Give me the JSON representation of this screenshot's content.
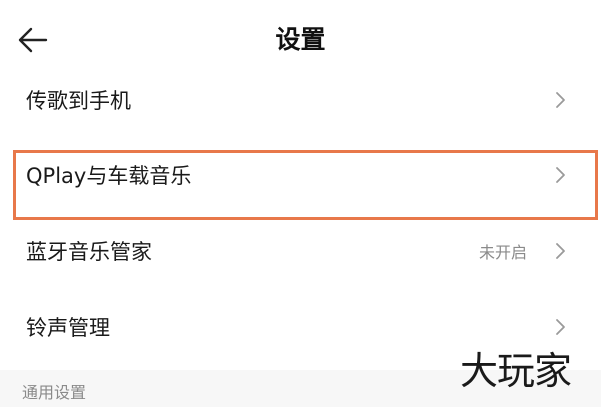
{
  "header": {
    "title": "设置",
    "back_icon": "arrow-left-icon"
  },
  "rows": [
    {
      "label": "传歌到手机",
      "status": "",
      "icon": "chevron-right-icon"
    },
    {
      "label": "QPlay与车载音乐",
      "status": "",
      "icon": "chevron-right-icon",
      "highlighted": true
    },
    {
      "label": "蓝牙音乐管家",
      "status": "未开启",
      "icon": "chevron-right-icon"
    },
    {
      "label": "铃声管理",
      "status": "",
      "icon": "chevron-right-icon"
    }
  ],
  "section": {
    "label": "通用设置"
  },
  "watermark": "大玩家",
  "colors": {
    "highlight": "#e8784a",
    "text": "#1a1a1a",
    "secondary_text": "#8a8a8a",
    "section_bg": "#f7f7f7"
  }
}
